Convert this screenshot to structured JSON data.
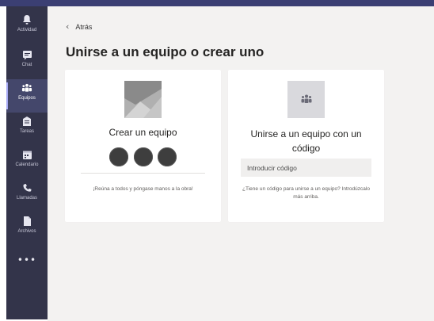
{
  "rail": {
    "items": [
      {
        "label": "Actividad",
        "icon": "bell-icon"
      },
      {
        "label": "Chat",
        "icon": "chat-icon"
      },
      {
        "label": "Equipos",
        "icon": "teams-icon",
        "active": true
      },
      {
        "label": "Tareas",
        "icon": "assignments-icon"
      },
      {
        "label": "Calendario",
        "icon": "calendar-icon"
      },
      {
        "label": "Llamadas",
        "icon": "phone-icon"
      },
      {
        "label": "Archivos",
        "icon": "files-icon"
      }
    ],
    "more": "•••"
  },
  "header": {
    "back_label": "Atrás",
    "title": "Unirse a un equipo o crear uno"
  },
  "create_card": {
    "title": "Crear un equipo",
    "description": "¡Reúna a todos y póngase manos a la obra!"
  },
  "join_card": {
    "title": "Unirse a un equipo con un código",
    "input_placeholder": "Introducir código",
    "description": "¿Tiene un código para unirse a un equipo? Introdúzcalo más arriba."
  },
  "colors": {
    "rail": "#33344a",
    "topbar": "#3b3f73",
    "accent": "#a7aaf5",
    "main_bg": "#f3f2f1"
  }
}
